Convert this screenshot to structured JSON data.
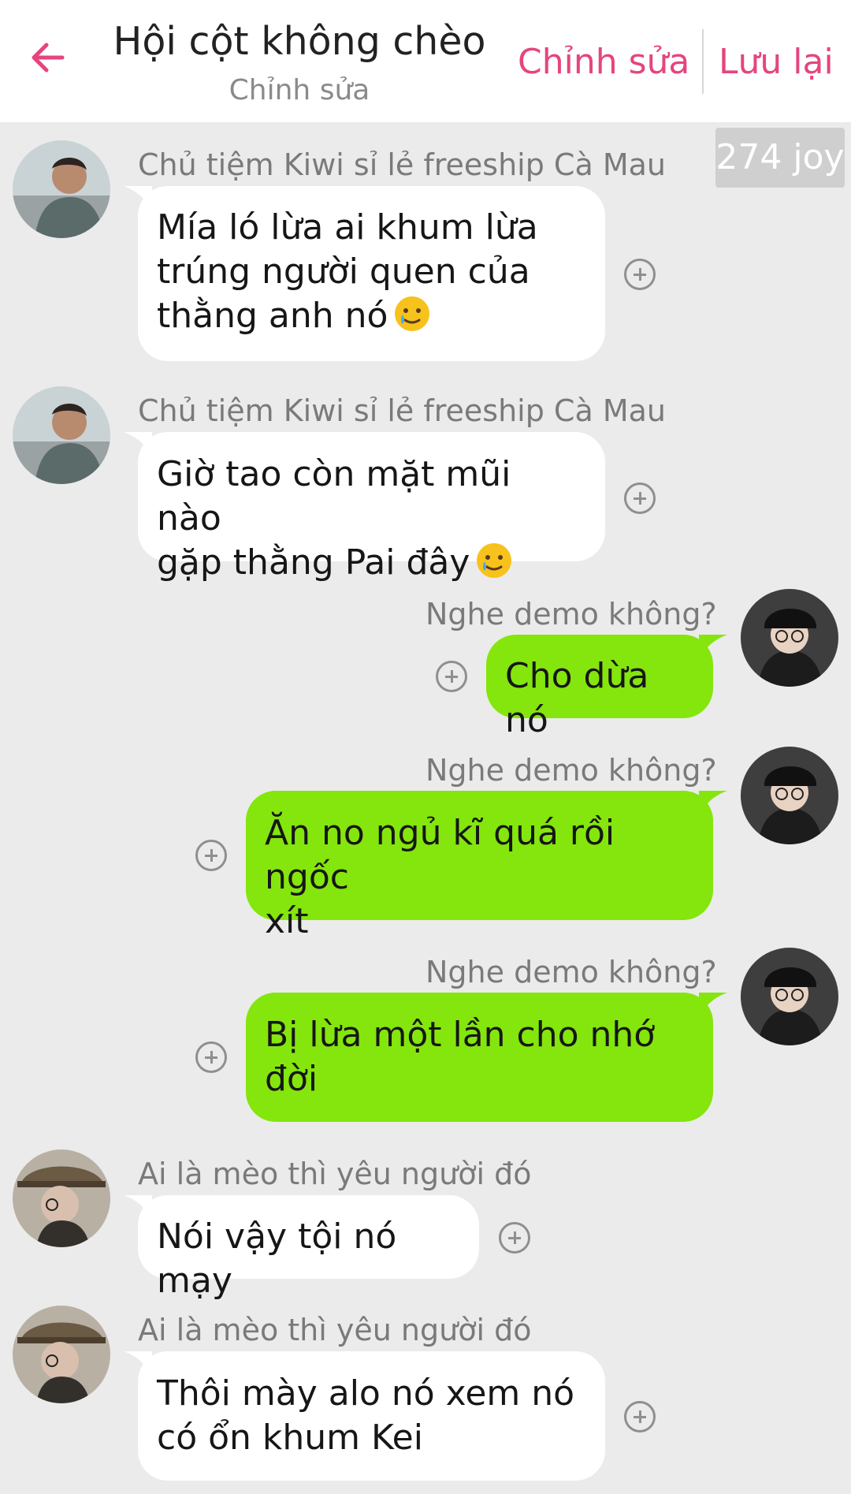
{
  "header": {
    "title": "Hội cột không chèo",
    "subtitle": "Chỉnh sửa",
    "edit_label": "Chỉnh sửa",
    "save_label": "Lưu lại",
    "back_icon": "arrow-left-icon",
    "accent_color": "#e5457f"
  },
  "points_badge": "274 joy",
  "colors": {
    "background": "#ebebeb",
    "incoming_bubble": "#ffffff",
    "outgoing_bubble": "#84e60c"
  },
  "messages": [
    {
      "sender": "Chủ tiệm Kiwi sỉ lẻ freeship Cà Mau",
      "direction": "incoming",
      "lines": [
        "Mía ló lừa ai khum lừa",
        "trúng người quen của",
        "thằng anh nó"
      ],
      "emoji": "crying-smile-emoji"
    },
    {
      "sender": "Chủ tiệm Kiwi sỉ lẻ freeship Cà Mau",
      "direction": "incoming",
      "lines": [
        "Giờ tao còn mặt mũi nào",
        "gặp thằng Pai đây"
      ],
      "emoji": "crying-smile-emoji"
    },
    {
      "sender": "Nghe demo không?",
      "direction": "outgoing",
      "lines": [
        "Cho dừa nó"
      ]
    },
    {
      "sender": "Nghe demo không?",
      "direction": "outgoing",
      "lines": [
        "Ăn no ngủ kĩ quá rồi ngốc",
        "xít"
      ]
    },
    {
      "sender": "Nghe demo không?",
      "direction": "outgoing",
      "lines": [
        "Bị lừa một lần cho nhớ",
        "đời"
      ]
    },
    {
      "sender": "Ai là mèo thì yêu người đó",
      "direction": "incoming",
      "lines": [
        "Nói vậy tội nó mạy"
      ]
    },
    {
      "sender": "Ai là mèo thì yêu người đó",
      "direction": "incoming",
      "lines": [
        "Thôi mày alo nó xem nó",
        "có ổn khum Kei"
      ]
    }
  ]
}
